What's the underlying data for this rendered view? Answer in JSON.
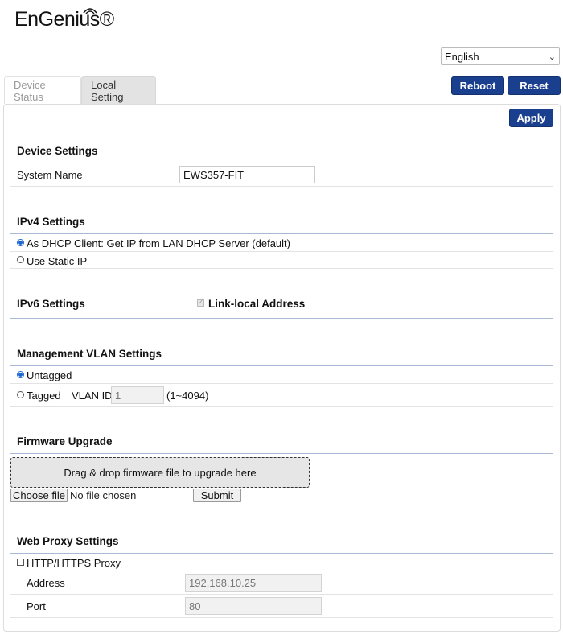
{
  "header": {
    "logo_text": "EnGenius®",
    "language": {
      "selected": "English"
    }
  },
  "tabs": [
    {
      "label": "Device Status",
      "active": false
    },
    {
      "label": "Local Setting",
      "active": true
    }
  ],
  "actions": {
    "reboot": "Reboot",
    "reset": "Reset",
    "apply": "Apply"
  },
  "device_settings": {
    "title": "Device Settings",
    "system_name_label": "System Name",
    "system_name_value": "EWS357-FIT"
  },
  "ipv4": {
    "title": "IPv4 Settings",
    "dhcp_label": "As DHCP Client: Get IP from LAN DHCP Server (default)",
    "dhcp_selected": true,
    "static_label": "Use Static IP"
  },
  "ipv6": {
    "title": "IPv6 Settings",
    "link_local_label": "Link-local Address",
    "link_local_checked": true
  },
  "mgmt_vlan": {
    "title": "Management VLAN Settings",
    "untagged_label": "Untagged",
    "untagged_selected": true,
    "tagged_label": "Tagged",
    "vlan_id_label": "VLAN ID",
    "vlan_id_value": "1",
    "vlan_range": "(1~4094)"
  },
  "firmware": {
    "title": "Firmware Upgrade",
    "dropzone_text": "Drag & drop firmware file to upgrade here",
    "choose_file": "Choose file",
    "no_file": "No file chosen",
    "submit": "Submit"
  },
  "web_proxy": {
    "title": "Web Proxy Settings",
    "proxy_label": "HTTP/HTTPS Proxy",
    "proxy_checked": false,
    "address_label": "Address",
    "address_value": "192.168.10.25",
    "port_label": "Port",
    "port_value": "80"
  },
  "colors": {
    "primary_button": "#1b3f8f",
    "section_rule": "#aab8d6"
  }
}
